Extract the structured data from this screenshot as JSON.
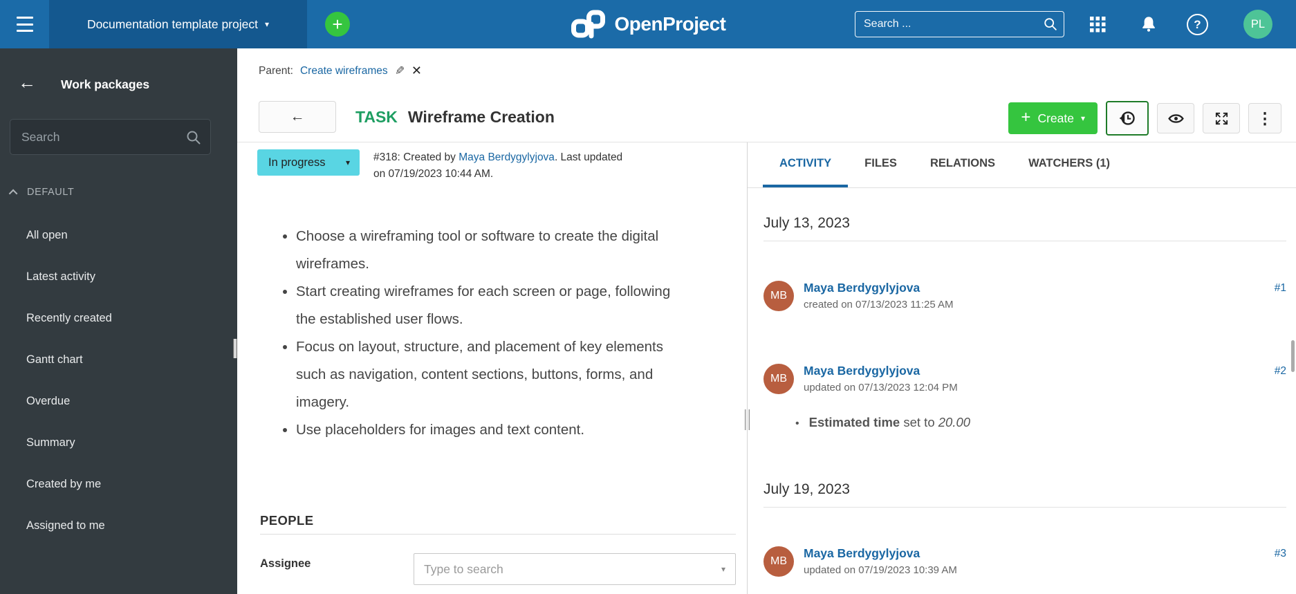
{
  "colors": {
    "accent": "#1A67A3",
    "topbar": "#1b6ba8",
    "project_block": "#14588f",
    "green": "#35c53f",
    "green_border": "#1e7b28",
    "type_task": "#1e9e62",
    "status_inprogress": "#59d5e3",
    "avatar_user": "#4ec497",
    "avatar_mb": "#b85e3f",
    "sidebar_bg": "#333b40"
  },
  "icons": {
    "plus": "+",
    "caret_down": "▾",
    "back_arrow": "←",
    "pencil": "✎",
    "close": "✕",
    "kebab": "⋮",
    "question": "?"
  },
  "topbar": {
    "project_selector": "Documentation template project",
    "logo": "OpenProject",
    "search_placeholder": "Search ...",
    "avatar_initials": "PL"
  },
  "sidebar": {
    "title": "Work packages",
    "search_placeholder": "Search",
    "section": "DEFAULT",
    "items": [
      "All open",
      "Latest activity",
      "Recently created",
      "Gantt chart",
      "Overdue",
      "Summary",
      "Created by me",
      "Assigned to me"
    ]
  },
  "work_package": {
    "parent_label": "Parent:",
    "parent_link": "Create wireframes",
    "type": "TASK",
    "title": "Wireframe Creation",
    "create_button": "Create",
    "status": "In progress",
    "meta_prefix": "#318: Created by ",
    "meta_author": "Maya Berdygylyjova",
    "meta_suffix": ". Last updated on 07/19/2023 10:44 AM."
  },
  "description": {
    "bullets": [
      "Choose a wireframing tool or software to create the digital wireframes.",
      "Start creating wireframes for each screen or page, following the established user flows.",
      "Focus on layout, structure, and placement of key elements such as navigation, content sections, buttons, forms, and imagery.",
      "Use placeholders for images and text content."
    ]
  },
  "people": {
    "heading": "PEOPLE",
    "assignee_label": "Assignee",
    "assignee_placeholder": "Type to search"
  },
  "tabs": [
    {
      "label": "ACTIVITY",
      "active": true
    },
    {
      "label": "FILES",
      "active": false
    },
    {
      "label": "RELATIONS",
      "active": false
    },
    {
      "label": "WATCHERS (1)",
      "active": false
    }
  ],
  "activity": {
    "groups": [
      {
        "date": "July 13, 2023",
        "entries": [
          {
            "initials": "MB",
            "name": "Maya Berdygylyjova",
            "meta": "created on 07/13/2023 11:25 AM",
            "ref": "#1"
          },
          {
            "initials": "MB",
            "name": "Maya Berdygylyjova",
            "meta": "updated on 07/13/2023 12:04 PM",
            "ref": "#2",
            "detail": {
              "bullet": "•",
              "property": "Estimated time",
              "verb": " set to ",
              "value": "20.00"
            }
          }
        ]
      },
      {
        "date": "July 19, 2023",
        "entries": [
          {
            "initials": "MB",
            "name": "Maya Berdygylyjova",
            "meta": "updated on 07/19/2023 10:39 AM",
            "ref": "#3"
          }
        ]
      }
    ]
  }
}
